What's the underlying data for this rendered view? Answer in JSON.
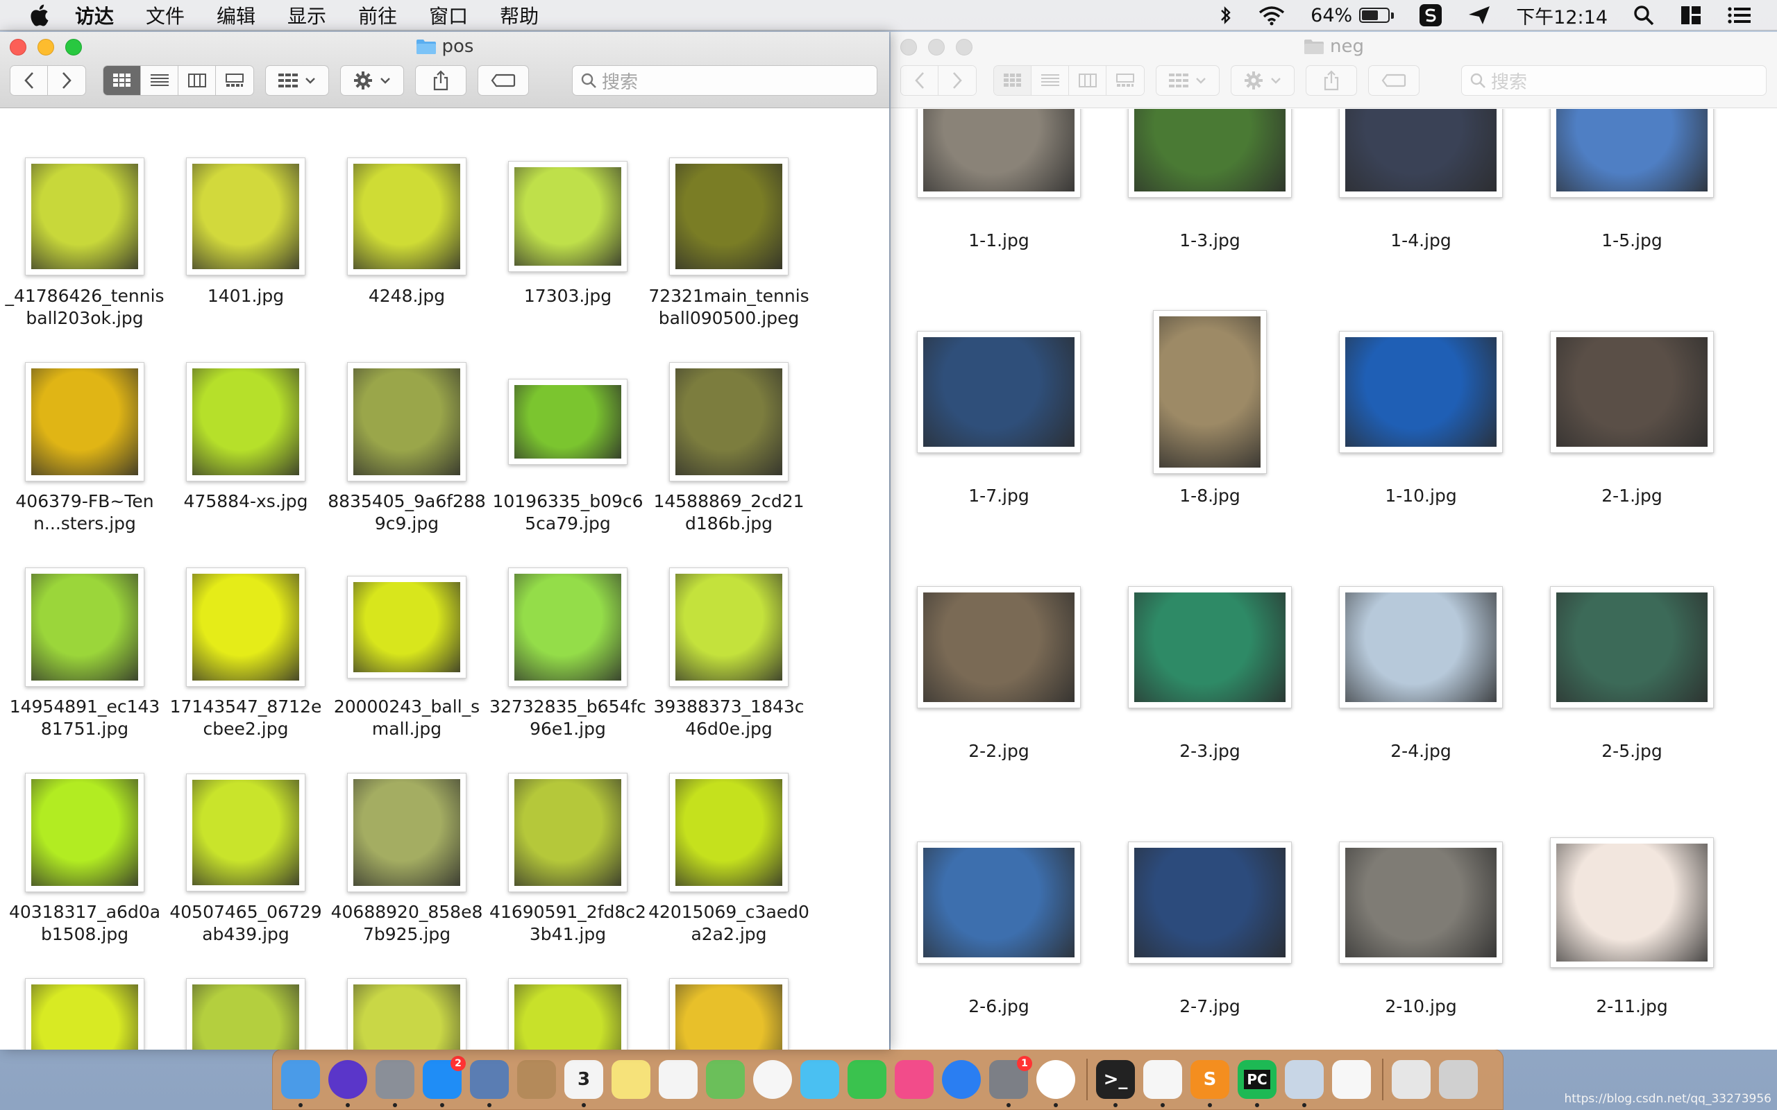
{
  "menubar": {
    "items": [
      "访达",
      "文件",
      "编辑",
      "显示",
      "前往",
      "窗口",
      "帮助"
    ],
    "battery": "64%",
    "time": "下午12:14"
  },
  "left_window": {
    "title": "pos",
    "search_placeholder": "搜索",
    "files": [
      {
        "name": "_41786426_tennisball203ok.jpg",
        "color": "#c8d83a"
      },
      {
        "name": "1401.jpg",
        "color": "#d2d93c"
      },
      {
        "name": "4248.jpg",
        "color": "#cfdc35"
      },
      {
        "name": "17303.jpg",
        "color": "#bfe04a"
      },
      {
        "name": "72321main_tennisball090500.jpeg",
        "color": "#7a7d25"
      },
      {
        "name": "406379-FB~Tenn...sters.jpg",
        "color": "#e0b515"
      },
      {
        "name": "475884-xs.jpg",
        "color": "#b6e02a"
      },
      {
        "name": "8835405_9a6f2889c9.jpg",
        "color": "#9aa64a"
      },
      {
        "name": "10196335_b09c65ca79.jpg",
        "color": "#7bc52f"
      },
      {
        "name": "14588869_2cd21d186b.jpg",
        "color": "#7c7d3e"
      },
      {
        "name": "14954891_ec14381751.jpg",
        "color": "#9bd63a"
      },
      {
        "name": "17143547_8712ecbee2.jpg",
        "color": "#e5ec18"
      },
      {
        "name": "20000243_ball_small.jpg",
        "color": "#d8e61c"
      },
      {
        "name": "32732835_b654fc96e1.jpg",
        "color": "#94dd49"
      },
      {
        "name": "39388373_1843c46d0e.jpg",
        "color": "#c4e23c"
      },
      {
        "name": "40318317_a6d0ab1508.jpg",
        "color": "#b2ec22"
      },
      {
        "name": "40507465_06729ab439.jpg",
        "color": "#c9e42b"
      },
      {
        "name": "40688920_858e87b925.jpg",
        "color": "#a4ad62"
      },
      {
        "name": "41690591_2fd8c23b41.jpg",
        "color": "#b5c83a"
      },
      {
        "name": "42015069_c3aed0a2a2.jpg",
        "color": "#c5e11d"
      },
      {
        "name": "",
        "color": "#d8ea23"
      },
      {
        "name": "",
        "color": "#b4cf3e"
      },
      {
        "name": "",
        "color": "#c9d746"
      },
      {
        "name": "",
        "color": "#c8e12a"
      },
      {
        "name": "",
        "color": "#e8c02a"
      }
    ]
  },
  "right_window": {
    "title": "neg",
    "search_placeholder": "搜索",
    "files": [
      {
        "name": "1-1.jpg",
        "color": "#8a8378"
      },
      {
        "name": "1-3.jpg",
        "color": "#4a7a34"
      },
      {
        "name": "1-4.jpg",
        "color": "#3a4256"
      },
      {
        "name": "1-5.jpg",
        "color": "#4f7fc4"
      },
      {
        "name": "1-7.jpg",
        "color": "#2f4f7a"
      },
      {
        "name": "1-8.jpg",
        "color": "#9d8a66"
      },
      {
        "name": "1-10.jpg",
        "color": "#1f5fb5"
      },
      {
        "name": "2-1.jpg",
        "color": "#5a4f47"
      },
      {
        "name": "2-2.jpg",
        "color": "#7a6a55"
      },
      {
        "name": "2-3.jpg",
        "color": "#2e8a66"
      },
      {
        "name": "2-4.jpg",
        "color": "#b7c9da"
      },
      {
        "name": "2-5.jpg",
        "color": "#3c6a58"
      },
      {
        "name": "2-6.jpg",
        "color": "#3d6fae"
      },
      {
        "name": "2-7.jpg",
        "color": "#2c4b7c"
      },
      {
        "name": "2-10.jpg",
        "color": "#7f7c75"
      },
      {
        "name": "2-11.jpg",
        "color": "#f2e6de"
      }
    ]
  },
  "dock": {
    "apps": [
      {
        "name": "finder",
        "color": "#4a9be8"
      },
      {
        "name": "siri",
        "color": "#5a36c9"
      },
      {
        "name": "launchpad",
        "color": "#8a8f98"
      },
      {
        "name": "app-store",
        "color": "#1f8df6",
        "badge": "2"
      },
      {
        "name": "xcode-preview",
        "color": "#5a7db3"
      },
      {
        "name": "contacts",
        "color": "#b48a5a"
      },
      {
        "name": "calendar",
        "color": "#f4f4f4",
        "text": "3"
      },
      {
        "name": "notes",
        "color": "#f6e27a"
      },
      {
        "name": "reminders",
        "color": "#f4f4f4"
      },
      {
        "name": "maps",
        "color": "#6bbf5a"
      },
      {
        "name": "photos",
        "color": "#f6f6f6"
      },
      {
        "name": "messages",
        "color": "#4ac0f2"
      },
      {
        "name": "facetime",
        "color": "#3ac24e"
      },
      {
        "name": "itunes",
        "color": "#f24c8a"
      },
      {
        "name": "safari",
        "color": "#2a7ef2"
      },
      {
        "name": "system-preferences",
        "color": "#7c7f86",
        "badge": "1"
      },
      {
        "name": "chrome",
        "color": "#ffffff"
      },
      {
        "name": "terminal",
        "color": "#222222",
        "text": ">_"
      },
      {
        "name": "textedit",
        "color": "#f6f6f6"
      },
      {
        "name": "sublime-text",
        "color": "#f48e1f",
        "text": "S"
      },
      {
        "name": "pycharm",
        "color": "#1db954",
        "text": "PC"
      },
      {
        "name": "preview",
        "color": "#c8d6e6"
      },
      {
        "name": "document",
        "color": "#f7f7f7"
      },
      {
        "name": "archive",
        "color": "#e6e6e6"
      },
      {
        "name": "trash",
        "color": "#d0d0d0"
      }
    ]
  },
  "watermark": "https://blog.csdn.net/qq_33273956"
}
